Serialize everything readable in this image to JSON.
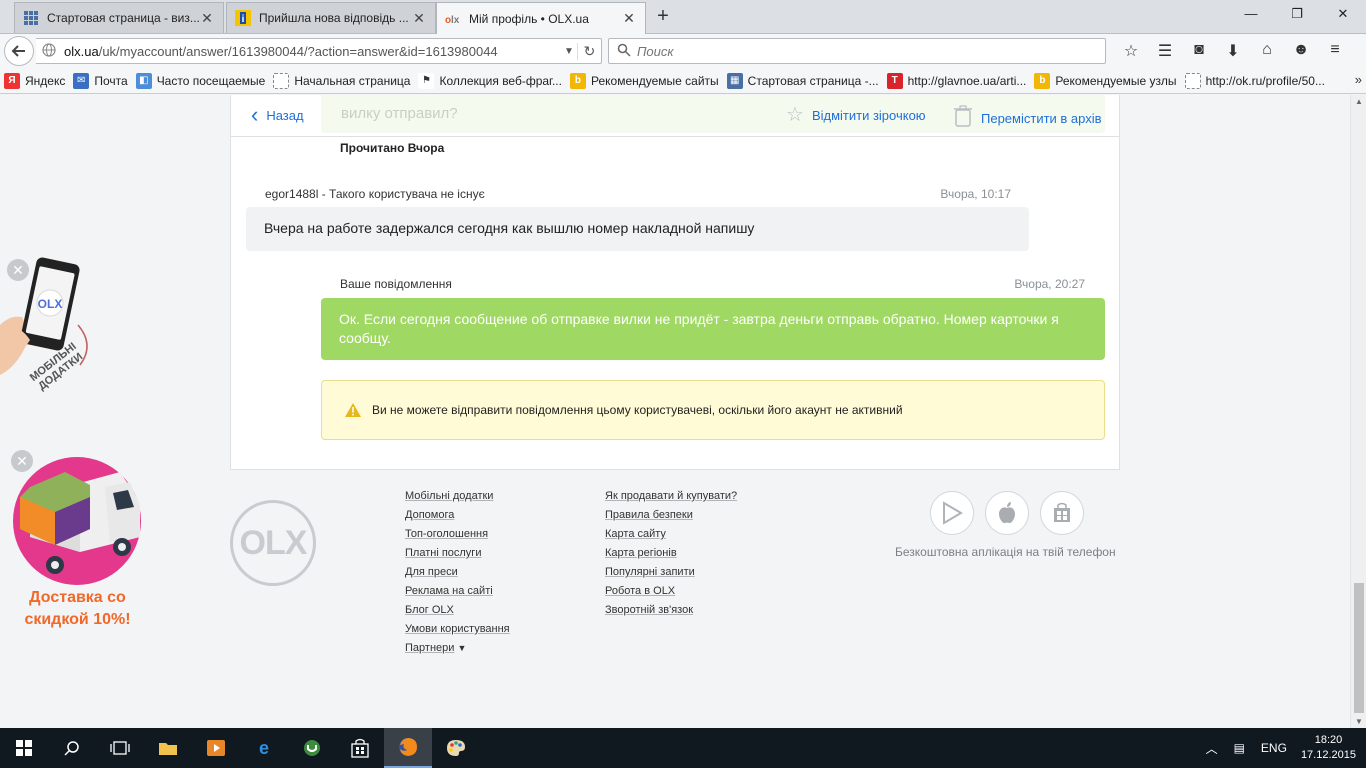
{
  "browser": {
    "tabs": [
      {
        "title": "Стартовая страница - виз...",
        "active": false
      },
      {
        "title": "Прийшла нова відповідь ...",
        "active": false
      },
      {
        "title": "Мій профіль • OLX.ua",
        "active": true
      }
    ],
    "url_host": "olx.ua",
    "url_path": "/uk/myaccount/answer/1613980044/?action=answer&id=1613980044",
    "search_placeholder": "Поиск",
    "bookmarks": [
      "Яндекс",
      "Почта",
      "Часто посещаемые",
      "Начальная страница",
      "Коллекция веб-фраг...",
      "Рекомендуемые сайты",
      "Стартовая страница -...",
      "http://glavnoe.ua/arti...",
      "Рекомендуемые узлы",
      "http://ok.ru/profile/50..."
    ]
  },
  "conversation": {
    "back_label": "Назад",
    "star_label": "Відмітити зірочкою",
    "archive_label": "Перемістити в архів",
    "ghost_text": "вилку отправил?",
    "read_status": "Прочитано Вчора",
    "incoming": {
      "sender": "egor1488l - Такого користувача не існує",
      "time": "Вчора, 10:17",
      "text": "Вчера на работе задержался сегодня как вышлю номер накладной напишу"
    },
    "outgoing": {
      "sender": "Ваше повідомлення",
      "time": "Вчора, 20:27",
      "text": "Ок. Если сегодня сообщение об отправке вилки не придёт - завтра деньги отправь обратно. Номер карточки я сообщу."
    },
    "warning": "Ви не можете відправити повідомлення цьому користувачеві, оскільки його акаунт не активний"
  },
  "footer": {
    "logo": "OLX",
    "col1": [
      "Мобільні додатки",
      "Допомога",
      "Топ-оголошення",
      "Платні послуги",
      "Для преси",
      "Реклама на сайті",
      "Блог OLX",
      "Умови користування",
      "Партнери"
    ],
    "col2": [
      "Як продавати й купувати?",
      "Правила безпеки",
      "Карта сайту",
      "Карта регіонів",
      "Популярні запити",
      "Робота в OLX",
      "Зворотній зв'язок"
    ],
    "app_caption": "Безкоштовна аплікація на твій телефон"
  },
  "promos": {
    "mobile_label": "МОБІЛЬНІ ДОДАТКИ",
    "delivery_text": "Доставка со скидкой 10%!"
  },
  "taskbar": {
    "lang": "ENG",
    "time": "18:20",
    "date": "17.12.2015"
  },
  "colors": {
    "link": "#1e6fd9",
    "outgoing_bubble": "#9fd964",
    "warning_bg": "#fffbd6",
    "delivery_orange": "#f2682a"
  }
}
